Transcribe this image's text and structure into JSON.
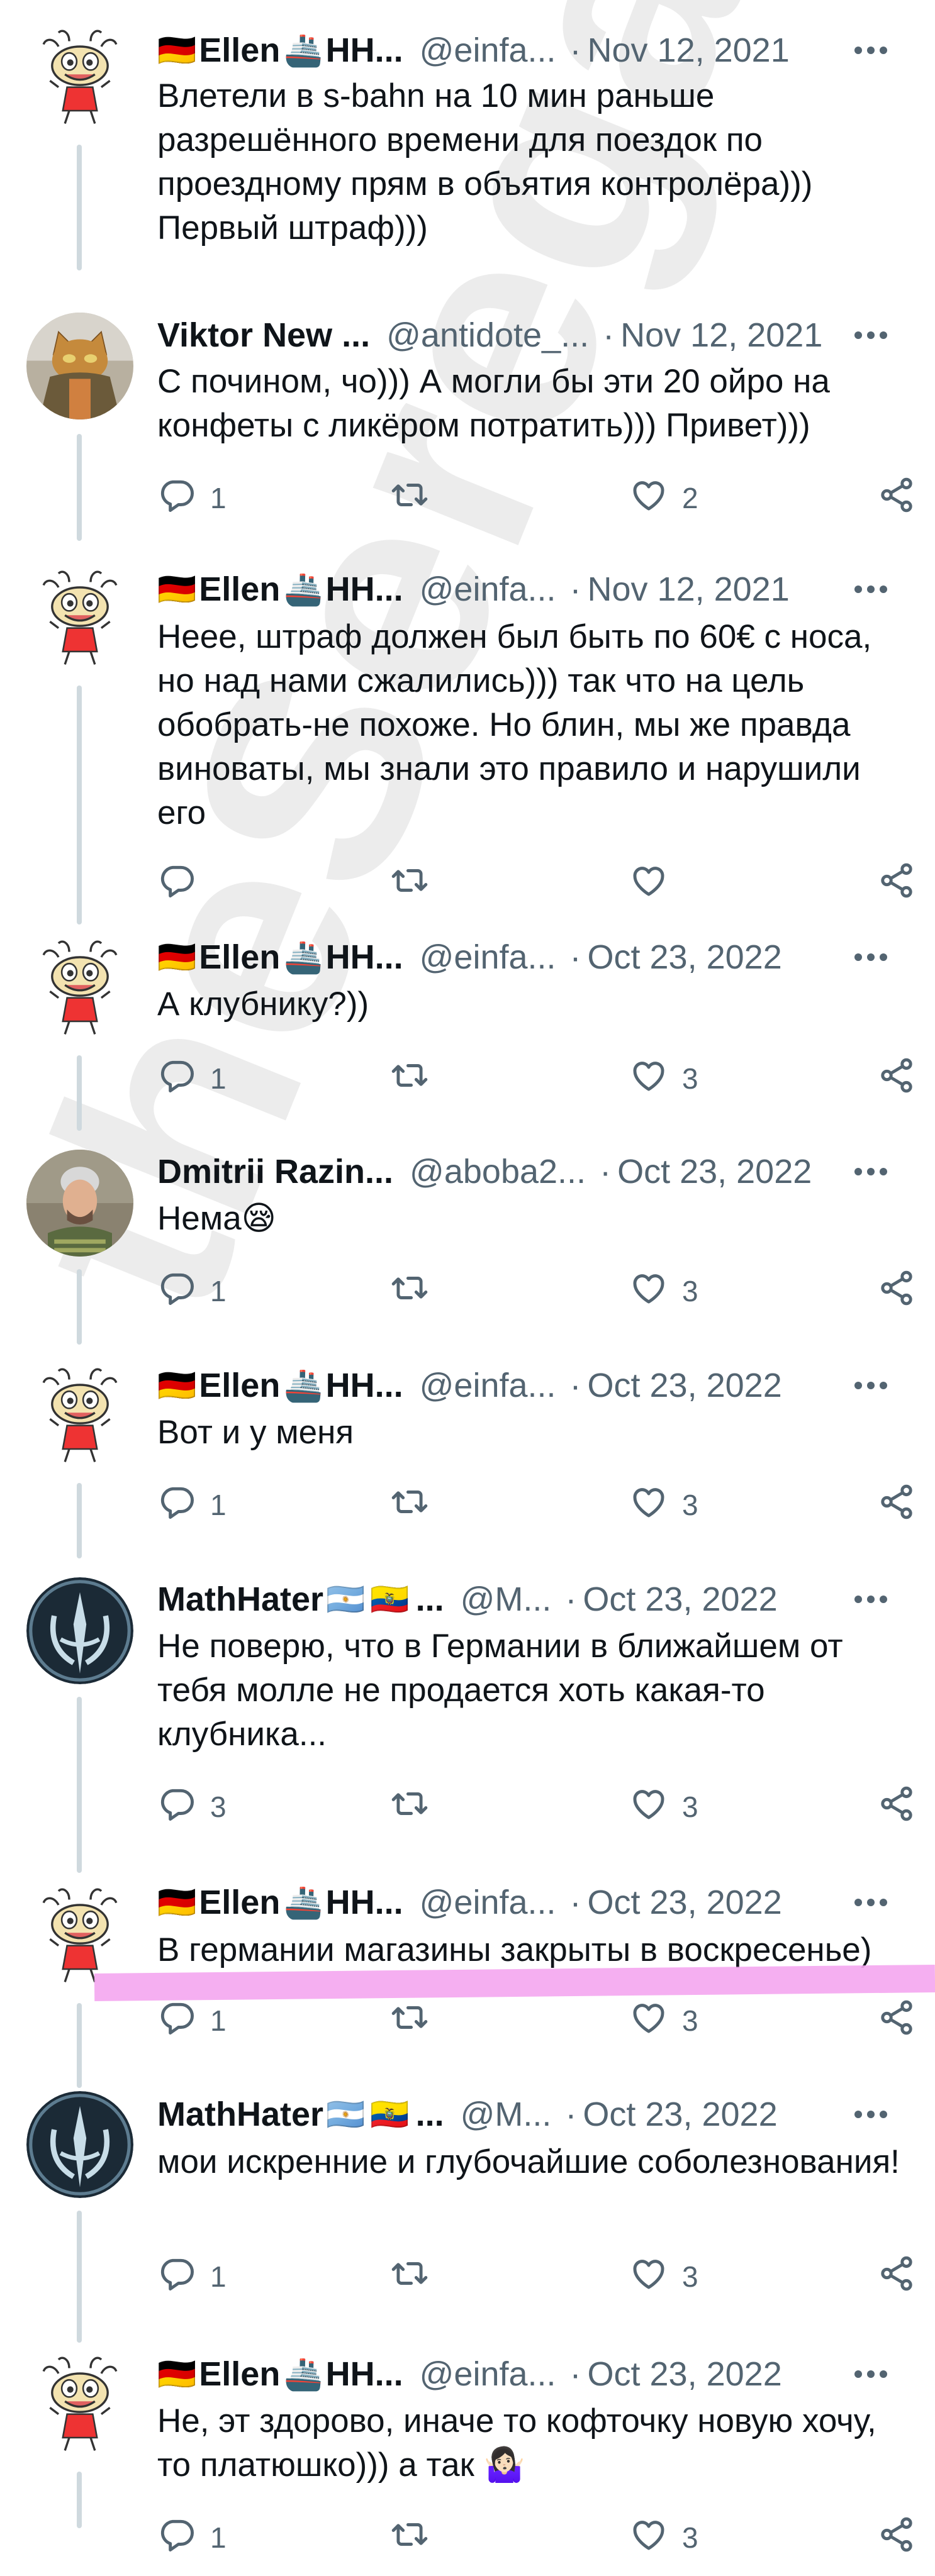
{
  "watermark": "theSeregaIzBatska",
  "posts": [
    {
      "avatar": "bird",
      "name": "Ellen",
      "flag": "🇩🇪",
      "ship": "🚢",
      "name_tail": "HH...",
      "handle": "@einfa...",
      "date": "Nov 12, 2021",
      "text": "Влетели в s-bahn на 10 мин раньше разрешённого времени для поездок по проездному прям в объятия контролёра))) Первый штраф)))",
      "reply_count": "",
      "like_count": ""
    },
    {
      "avatar": "cat",
      "name": "Viktor New ...",
      "flag": "",
      "ship": "",
      "name_tail": "",
      "handle": "@antidote_...",
      "date": "Nov 12, 2021",
      "text": "С почином, чо))) А могли бы эти 20 ойро на конфеты с ликёром потратить))) Привет)))",
      "reply_count": "1",
      "like_count": "2"
    },
    {
      "avatar": "bird",
      "name": "Ellen",
      "flag": "🇩🇪",
      "ship": "🚢",
      "name_tail": "HH...",
      "handle": "@einfa...",
      "date": "Nov 12, 2021",
      "text": "Неее, штраф должен был быть по 60€ с носа, но над нами сжалились))) так что на цель обобрать-не похоже. Но блин, мы же правда виноваты, мы знали это правило и нарушили его",
      "reply_count": "",
      "like_count": ""
    },
    {
      "avatar": "bird",
      "name": "Ellen",
      "flag": "🇩🇪",
      "ship": "🚢",
      "name_tail": "HH...",
      "handle": "@einfa...",
      "date": "Oct 23, 2022",
      "text": "А клубнику?))",
      "reply_count": "1",
      "like_count": "3"
    },
    {
      "avatar": "man",
      "name": "Dmitrii Razin...",
      "flag": "",
      "ship": "",
      "name_tail": "",
      "handle": "@aboba2...",
      "date": "Oct 23, 2022",
      "text": "Нема😪",
      "reply_count": "1",
      "like_count": "3"
    },
    {
      "avatar": "bird",
      "name": "Ellen",
      "flag": "🇩🇪",
      "ship": "🚢",
      "name_tail": "HH...",
      "handle": "@einfa...",
      "date": "Oct 23, 2022",
      "text": "Вот и у меня",
      "reply_count": "1",
      "like_count": "3"
    },
    {
      "avatar": "jedi",
      "name": "MathHater",
      "flag": "🇦🇷",
      "ship": "🇪🇨",
      "name_tail": "...",
      "handle": "@M...",
      "date": "Oct 23, 2022",
      "text": "Не поверю, что в Германии в ближайшем от тебя молле не продается хоть какая-то клубника...",
      "reply_count": "3",
      "like_count": "3"
    },
    {
      "avatar": "bird",
      "name": "Ellen",
      "flag": "🇩🇪",
      "ship": "🚢",
      "name_tail": "HH...",
      "handle": "@einfa...",
      "date": "Oct 23, 2022",
      "text": "В германии магазины закрыты в воскресенье)",
      "reply_count": "1",
      "like_count": "3"
    },
    {
      "avatar": "jedi",
      "name": "MathHater",
      "flag": "🇦🇷",
      "ship": "🇪🇨",
      "name_tail": "...",
      "handle": "@M...",
      "date": "Oct 23, 2022",
      "text": "мои искренние и глубочайшие соболезнования!",
      "reply_count": "1",
      "like_count": "3"
    },
    {
      "avatar": "bird",
      "name": "Ellen",
      "flag": "🇩🇪",
      "ship": "🚢",
      "name_tail": "HH...",
      "handle": "@einfa...",
      "date": "Oct 23, 2022",
      "text": "Не, эт здорово, иначе то кофточку новую хочу, то платюшко))) а так 🤷🏻‍♀️",
      "reply_count": "1",
      "like_count": "3"
    }
  ]
}
